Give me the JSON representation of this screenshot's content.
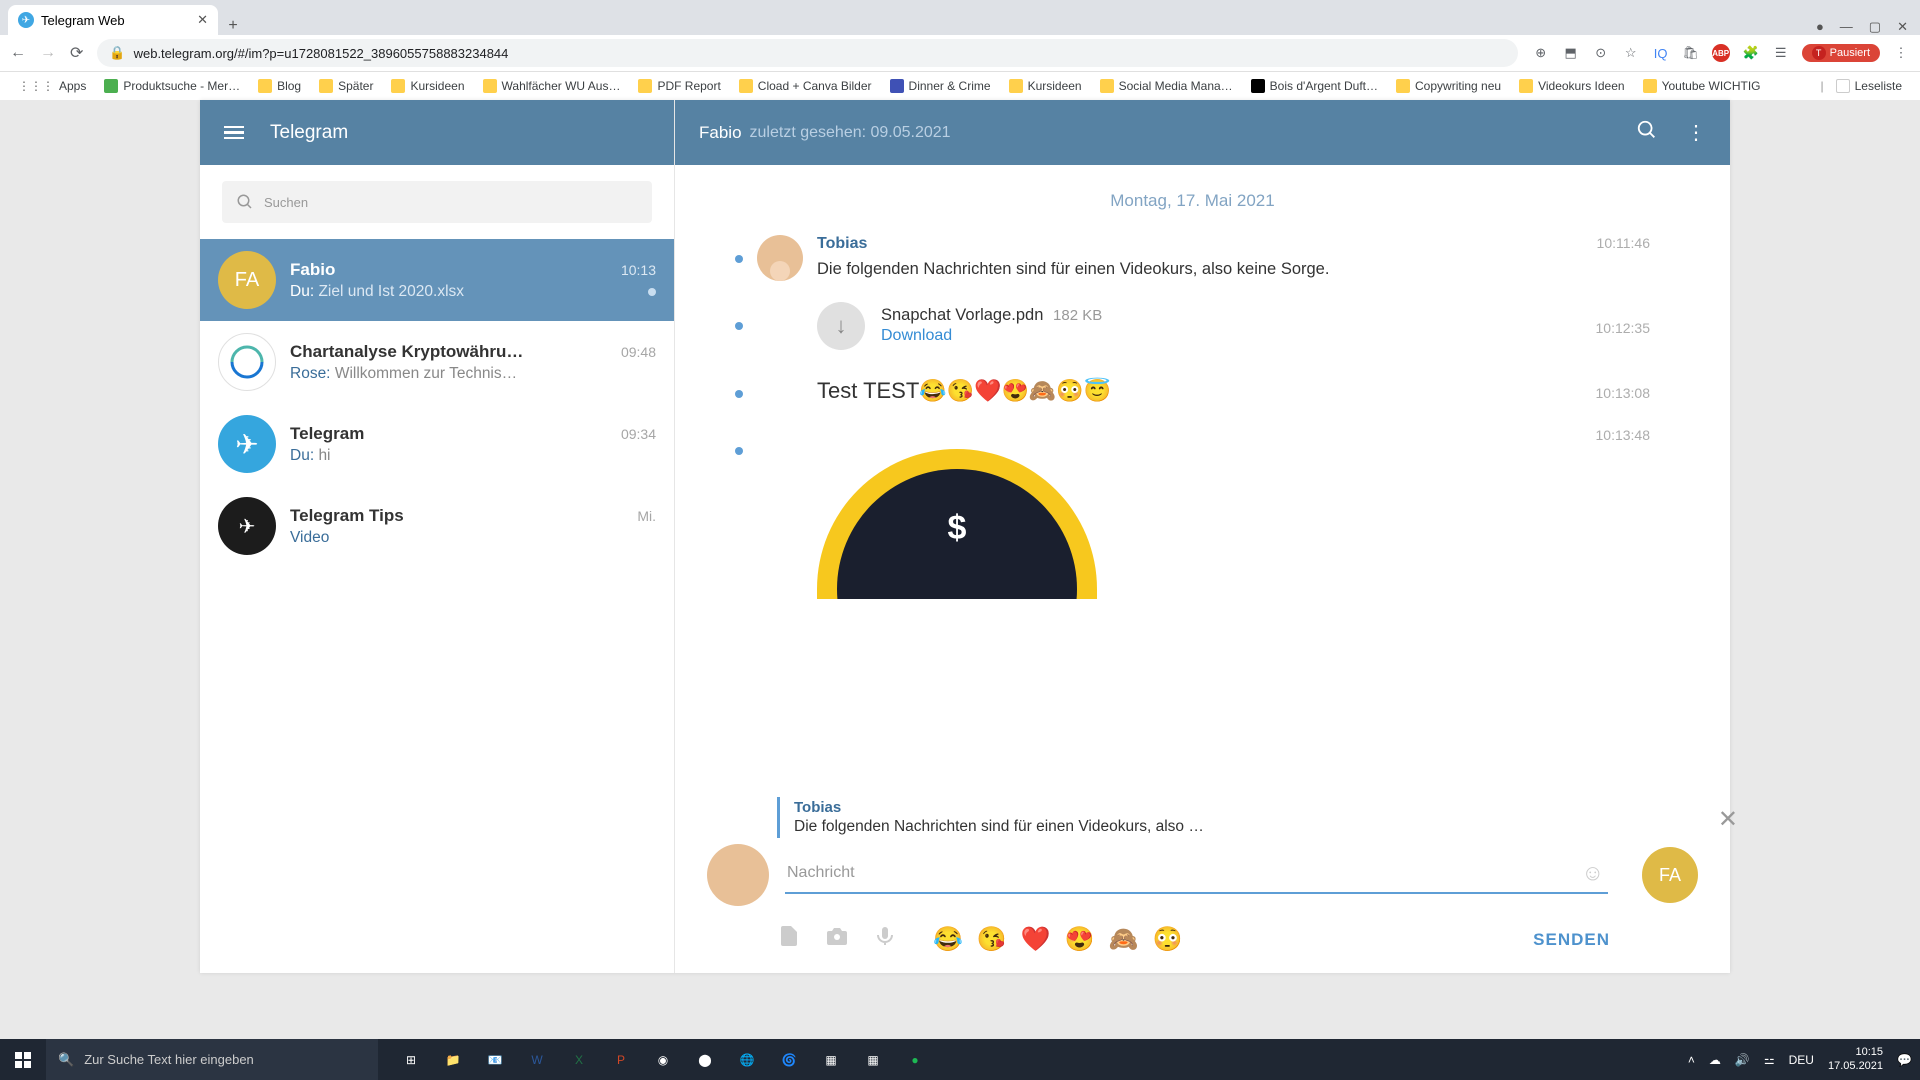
{
  "browser": {
    "tab_title": "Telegram Web",
    "url": "web.telegram.org/#/im?p=u1728081522_3896055758883234844",
    "profile_label": "Pausiert",
    "bookmarks": [
      "Apps",
      "Produktsuche - Mer…",
      "Blog",
      "Später",
      "Kursideen",
      "Wahlfächer WU Aus…",
      "PDF Report",
      "Cload + Canva Bilder",
      "Dinner & Crime",
      "Kursideen",
      "Social Media Mana…",
      "Bois d'Argent Duft…",
      "Copywriting neu",
      "Videokurs Ideen",
      "Youtube WICHTIG",
      "Leseliste"
    ]
  },
  "app": {
    "name": "Telegram"
  },
  "sidebar": {
    "search_placeholder": "Suchen",
    "chats": [
      {
        "name": "Fabio",
        "time": "10:13",
        "prefix": "Du: ",
        "msg": "Ziel und Ist 2020.xlsx",
        "initials": "FA",
        "sel": true
      },
      {
        "name": "Chartanalyse Kryptowähru…",
        "time": "09:48",
        "prefix": "Rose: ",
        "msg": "Willkommen zur Technis…"
      },
      {
        "name": "Telegram",
        "time": "09:34",
        "prefix": "Du: ",
        "msg": "hi"
      },
      {
        "name": "Telegram Tips",
        "time": "Mi.",
        "prefix": "",
        "msg": "Video"
      }
    ]
  },
  "chat_header": {
    "name": "Fabio",
    "status": "zuletzt gesehen: 09.05.2021"
  },
  "messages": {
    "date": "Montag, 17. Mai 2021",
    "items": [
      {
        "sender": "Tobias",
        "time": "10:11:46",
        "text": "Die folgenden Nachrichten sind für einen Videokurs, also keine Sorge."
      },
      {
        "time": "10:12:35",
        "file": {
          "name": "Snapchat Vorlage.pdn",
          "size": "182 KB",
          "dl": "Download"
        }
      },
      {
        "time": "10:13:08",
        "emoji": "Test TEST😂😘❤️😍🙈😳😇"
      },
      {
        "time": "10:13:48",
        "image": true
      }
    ]
  },
  "compose": {
    "reply_name": "Tobias",
    "reply_text": "Die folgenden Nachrichten sind für einen Videokurs, also …",
    "placeholder": "Nachricht",
    "send": "SENDEN",
    "recipient_initials": "FA",
    "emoji_strip": "😂😘❤️😍🙈😳"
  },
  "taskbar": {
    "search_placeholder": "Zur Suche Text hier eingeben",
    "lang": "DEU",
    "time": "10:15",
    "date": "17.05.2021"
  }
}
